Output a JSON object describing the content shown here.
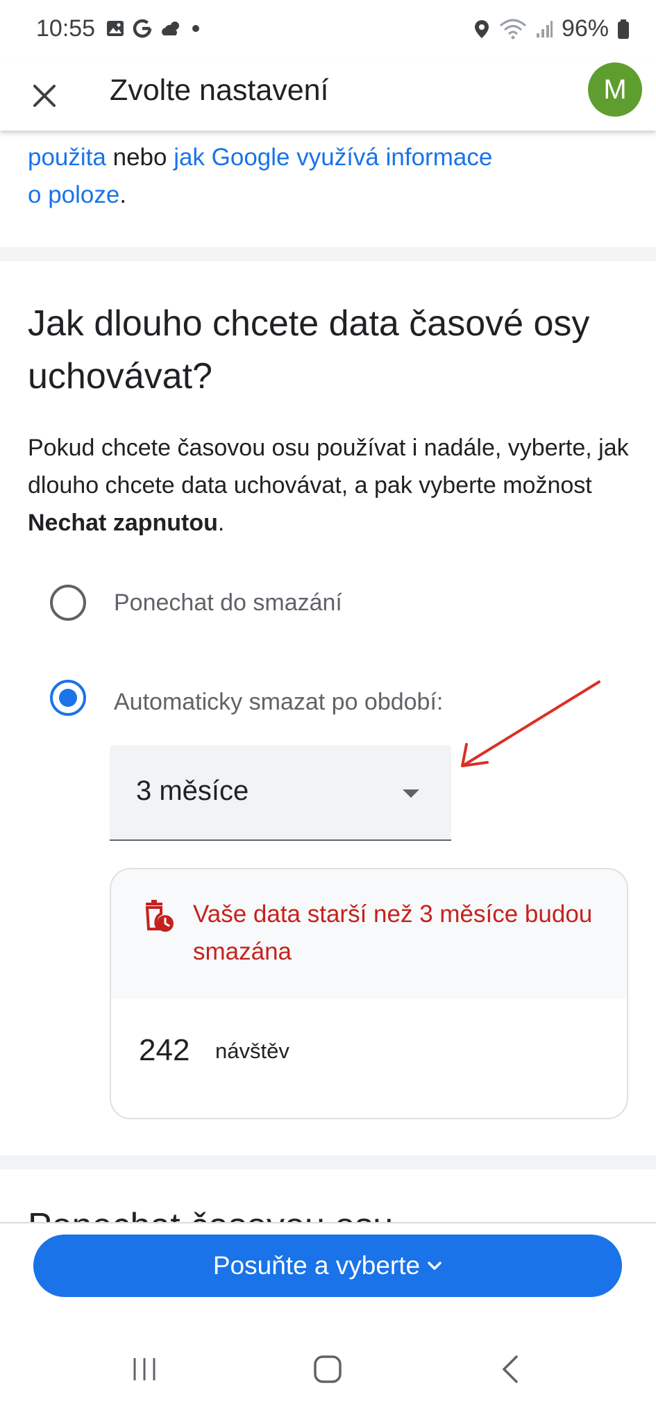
{
  "status_bar": {
    "time": "10:55",
    "battery": "96%",
    "icons_left": [
      "gallery-icon",
      "google-icon",
      "weather-icon",
      "dot-icon"
    ],
    "icons_right": [
      "location-icon",
      "wifi-icon",
      "signal-icon",
      "battery-icon"
    ]
  },
  "app_bar": {
    "title": "Zvolte nastavení",
    "avatar_letter": "M",
    "avatar_color": "#5e9e2e"
  },
  "top_partial": {
    "link1": "použita",
    "mid_text": " nebo ",
    "link2_line1": "jak Google využívá informace",
    "link2_line2": "o poloze",
    "end": "."
  },
  "section": {
    "title": "Jak dlouho chcete data časové osy uchovávat?",
    "desc_pre": "Pokud chcete časovou osu používat i nadále, vyberte, jak dlouho chcete data uchovávat, a pak vyberte možnost ",
    "desc_bold": "Nechat zapnutou",
    "desc_post": "."
  },
  "options": [
    {
      "label": "Ponechat do smazání",
      "checked": false
    },
    {
      "label": "Automaticky smazat po období:",
      "checked": true
    }
  ],
  "dropdown": {
    "value": "3 měsíce"
  },
  "info_card": {
    "warning": "Vaše data starší než 3 měsíce budou smazána",
    "count": "242",
    "count_label": "návštěv"
  },
  "next_section_title": "Ponechat časovou osu",
  "bottom": {
    "button_label": "Posuňte a vyberte"
  },
  "colors": {
    "accent": "#1a73e8",
    "warning": "#c5221f",
    "annotation_arrow": "#d93025"
  }
}
